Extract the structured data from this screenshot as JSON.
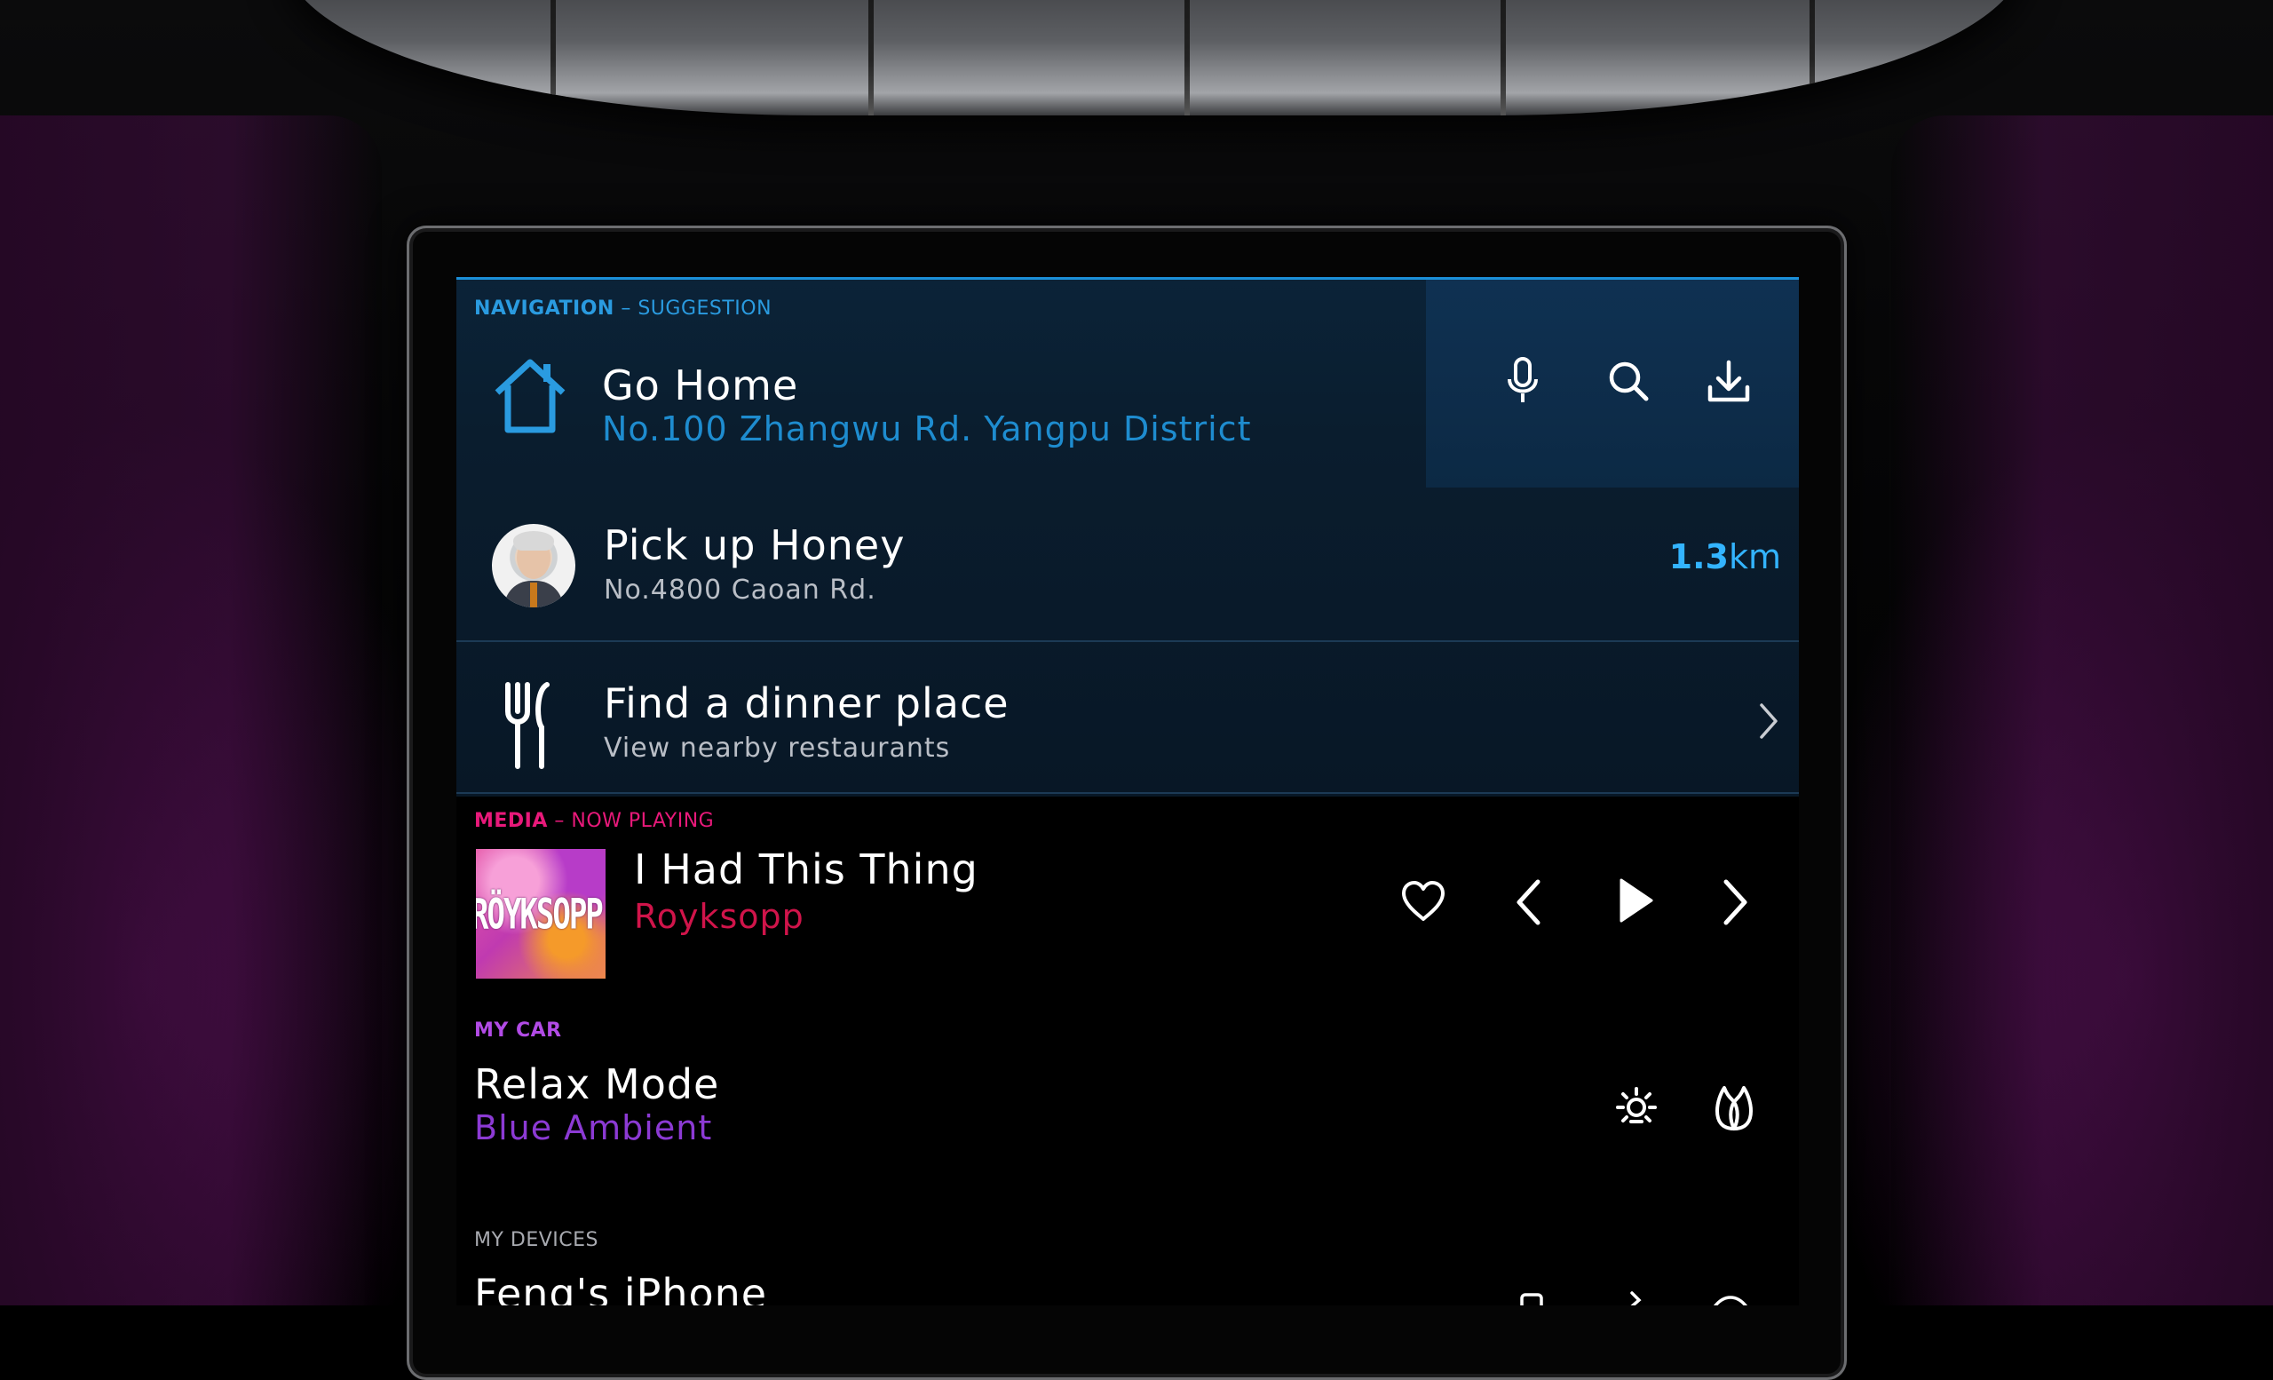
{
  "navigation": {
    "label": "NAVIGATION",
    "label_suffix": "– SUGGESTION",
    "go_home": {
      "title": "Go Home",
      "address": "No.100 Zhangwu Rd. Yangpu District",
      "icon": "house-icon"
    },
    "actions": [
      "microphone-icon",
      "search-icon",
      "download-icon"
    ],
    "pickup": {
      "title": "Pick up Honey",
      "address": "No.4800 Caoan Rd.",
      "distance_value": "1.3",
      "distance_unit": "km"
    },
    "dinner": {
      "title": "Find a dinner place",
      "subtitle": "View nearby restaurants",
      "icon": "fork-knife-icon"
    }
  },
  "media": {
    "label": "MEDIA",
    "label_suffix": "– NOW PLAYING",
    "track": "I Had This Thing",
    "artist": "Royksopp",
    "album_art_text": "RÖYKSOPP",
    "controls": [
      "heart-icon",
      "previous-icon",
      "play-icon",
      "next-icon"
    ]
  },
  "my_car": {
    "label": "MY CAR",
    "mode": "Relax Mode",
    "ambient": "Blue Ambient",
    "controls": [
      "light-icon",
      "scent-icon"
    ]
  },
  "my_devices": {
    "label": "MY DEVICES",
    "device": "Feng's iPhone"
  },
  "colors": {
    "nav_accent": "#2a9be0",
    "distance": "#33b4ff",
    "media_accent": "#e8197a",
    "artist": "#d0144a",
    "car_accent": "#b24be6"
  }
}
